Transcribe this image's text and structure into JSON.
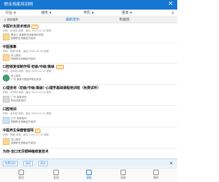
{
  "header": {
    "title": "职业技能培训网",
    "close_label": "✕"
  },
  "filters": {
    "items": [
      {
        "label": "行业"
      },
      {
        "label": "城市"
      },
      {
        "label": "学历"
      },
      {
        "label": "更多"
      }
    ],
    "search_icon": "search-icon"
  },
  "sorts": {
    "dropdown": "◇ 综合排序",
    "items": [
      {
        "label": "最新发布"
      },
      {
        "label": "年底前"
      }
    ]
  },
  "listings": [
    {
      "title": "中医针灸技术培训",
      "tag": "VIP",
      "meta": "学制：全年制   收费：面议   2025-02-28 更新",
      "org": "黑龙江·某某职业技能培训学校",
      "org2": "国家职业资格证书培训",
      "thumb": "orange"
    },
    {
      "title": "中医推拿",
      "tag": "",
      "meta": "学制：短期    收费：面议   2025-02-26 更新",
      "org": "线上报名",
      "org2": "国家职业资格证书培训",
      "thumb": "orange"
    },
    {
      "title": "口腔修复体制作师·初级/中级/高级",
      "tag": "认证",
      "meta": "学制：全年制   收费：面议   2025-02-25 更新",
      "org": "线上报名",
      "org2": "广东·某某口腔医学职业培训",
      "thumb": "green"
    },
    {
      "title": "心理咨询（初级/中级/高级）·心理学基础课程培训班（免费试听）",
      "tag": "",
      "meta": "学制：半年制   收费：面议   2025-02-24 更新",
      "org": "广东·某某学校",
      "org2": "职业技能培训",
      "thumb": "gray"
    },
    {
      "title": "口腔培训",
      "tag": "",
      "meta": "学制：全年制   收费：面议   2025-02-22 更新",
      "org": "辽宁·某某培训",
      "org2": "国家职业资格证书培训",
      "thumb": "blue"
    },
    {
      "title": "中医养生保健管理师",
      "tag": "热",
      "meta": "学制：短期    收费：面议   2025-02-20 更新",
      "org": "线上报名",
      "org2": "国家职业资格证书培训",
      "thumb": "orange"
    },
    {
      "title": "为你·全口无牙颌种植修复技术",
      "tag": "",
      "meta": "",
      "org": "",
      "org2": "",
      "thumb": "none"
    }
  ],
  "bottom_ad": {
    "chips": [
      {
        "label": "免费试听"
      },
      {
        "label": "咨询"
      },
      {
        "label": "报名"
      }
    ],
    "close_label": "✕"
  },
  "tabbar": {
    "items": [
      {
        "label": "首页",
        "icon": "home-icon"
      },
      {
        "label": "发现",
        "icon": "compass-icon"
      },
      {
        "label": "课程",
        "icon": "book-icon"
      },
      {
        "label": "消息",
        "icon": "message-icon"
      },
      {
        "label": "我的",
        "icon": "user-icon"
      }
    ],
    "active_index": 2
  },
  "colors": {
    "brand": "#1677d2",
    "accent_tag": "#f39c12"
  }
}
